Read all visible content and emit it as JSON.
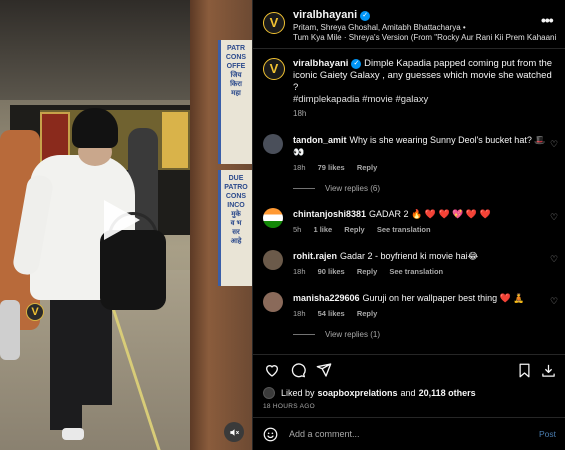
{
  "header": {
    "username": "viralbhayani",
    "avatar_letter": "V",
    "artists": "Pritam, Shreya Ghoshal, Amitabh Bhattacharya •",
    "song": "Tum Kya Mile · Shreya's Version (From \"Rocky Aur Rani Kii Prem Kahaani",
    "more_icon": "more-horizontal-icon"
  },
  "caption": {
    "username": "viralbhayani",
    "text": "Dimple Kapadia papped coming put from the iconic Gaiety Galaxy , any guesses which movie she watched ?",
    "hashtags": "#dimplekapadia #movie #galaxy",
    "time": "18h"
  },
  "comments": [
    {
      "username": "tandon_amit",
      "text": "Why is she wearing Sunny Deol's bucket hat? 🎩👀",
      "time": "18h",
      "likes": "79 likes",
      "reply": "Reply",
      "translation": "",
      "avatar_color": "#4a4f5a",
      "view_replies": "View replies (6)"
    },
    {
      "username": "chintanjoshi8381",
      "text": "GADAR 2 🔥 ❤️ ❤️ 💖 ❤️ ❤️",
      "time": "5h",
      "likes": "1 like",
      "reply": "Reply",
      "translation": "See translation",
      "avatar_color": "#ff9933",
      "view_replies": ""
    },
    {
      "username": "rohit.rajen",
      "text": "Gadar 2 - boyfriend ki movie hai😂",
      "time": "18h",
      "likes": "90 likes",
      "reply": "Reply",
      "translation": "See translation",
      "avatar_color": "#6b5a4a",
      "view_replies": ""
    },
    {
      "username": "manisha229606",
      "text": "Guruji on her wallpaper best thing ❤️ 🧘",
      "time": "18h",
      "likes": "54 likes",
      "reply": "Reply",
      "translation": "",
      "avatar_color": "#8a6a5a",
      "view_replies": "View replies (1)"
    }
  ],
  "video": {
    "sign_top": "PATR\nCONS\nOFFE\nजिय\nकिरा\nमहा\n",
    "sign_bottom": "DUE\nPATRO\nCONS\nINCO\nमुके\nव भ\nसर\nआहे",
    "watermark": "V"
  },
  "likes": {
    "prefix": "Liked by",
    "user": "soapboxprelations",
    "and": "and",
    "count": "20,118 others"
  },
  "posted_ago": "18 HOURS AGO",
  "add_comment": {
    "placeholder": "Add a comment...",
    "post_label": "Post"
  },
  "colors": {
    "accent": "#0095f6",
    "brand_gold": "#f1c232",
    "background": "#000000",
    "muted_text": "#a8a8a8",
    "heart_red": "#ed4956"
  }
}
